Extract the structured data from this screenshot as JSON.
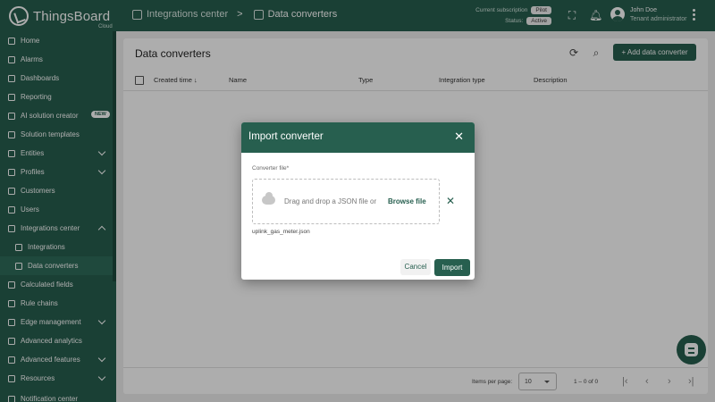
{
  "brand": {
    "name": "ThingsBoard",
    "sub": "Cloud"
  },
  "breadcrumb": {
    "parent": "Integrations center",
    "separator": ">",
    "current": "Data converters"
  },
  "subscription": {
    "label": "Current subscription",
    "plan": "Pilot",
    "status_label": "Status:",
    "status": "Active"
  },
  "user": {
    "name": "John Doe",
    "role": "Tenant administrator"
  },
  "sidebar": {
    "items": [
      {
        "label": "Home",
        "icon": "home-icon"
      },
      {
        "label": "Alarms",
        "icon": "alarm-icon"
      },
      {
        "label": "Dashboards",
        "icon": "dashboard-icon"
      },
      {
        "label": "Reporting",
        "icon": "report-icon"
      },
      {
        "label": "AI solution creator",
        "icon": "ai-icon",
        "badge": "NEW"
      },
      {
        "label": "Solution templates",
        "icon": "template-icon"
      },
      {
        "label": "Entities",
        "icon": "entities-icon"
      },
      {
        "label": "Profiles",
        "icon": "profiles-icon"
      },
      {
        "label": "Customers",
        "icon": "customers-icon"
      },
      {
        "label": "Users",
        "icon": "users-icon"
      },
      {
        "label": "Integrations center",
        "icon": "integrations-icon"
      },
      {
        "label": "Integrations",
        "icon": "integration-icon"
      },
      {
        "label": "Data converters",
        "icon": "converter-icon"
      },
      {
        "label": "Calculated fields",
        "icon": "calc-icon"
      },
      {
        "label": "Rule chains",
        "icon": "rule-icon"
      },
      {
        "label": "Edge management",
        "icon": "edge-icon"
      },
      {
        "label": "Advanced analytics",
        "icon": "analytics-icon"
      },
      {
        "label": "Advanced features",
        "icon": "features-icon"
      },
      {
        "label": "Resources",
        "icon": "resources-icon"
      },
      {
        "label": "Notification center",
        "icon": "notification-icon"
      }
    ]
  },
  "main": {
    "title": "Data converters",
    "add_button": "+ Add data converter",
    "columns": [
      "Created time",
      "Name",
      "Type",
      "Integration type",
      "Description"
    ],
    "sort_indicator": "↓",
    "footer": {
      "items_per_page_label": "Items per page:",
      "items_per_page": "10",
      "range": "1 – 0 of 0"
    }
  },
  "dialog": {
    "title": "Import converter",
    "field_label": "Converter file*",
    "drop_text": "Drag and drop a JSON file or",
    "browse": "Browse file",
    "file_name": "uplink_gas_meter.json",
    "cancel": "Cancel",
    "import": "Import"
  },
  "colors": {
    "primary": "#275f4f",
    "background": "#eeeeee"
  }
}
